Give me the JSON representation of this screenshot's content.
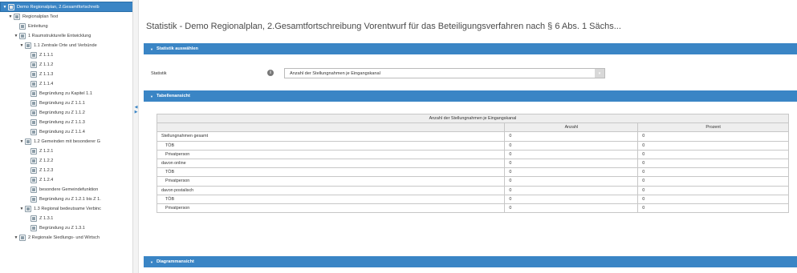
{
  "sidebar": {
    "items": [
      {
        "label": "Demo Regionalplan, 2.Gesamtfortschreib",
        "caret": "▼",
        "selected": true
      },
      {
        "label": "Regionalplan Text",
        "caret": "▼"
      },
      {
        "label": "Einleitung",
        "caret": ""
      },
      {
        "label": "1 Raumstrukturelle Entwicklung",
        "caret": "▼"
      },
      {
        "label": "1.1 Zentrale Orte und Verbünde",
        "caret": "▼"
      },
      {
        "label": "Z 1.1.1",
        "caret": ""
      },
      {
        "label": "Z 1.1.2",
        "caret": ""
      },
      {
        "label": "Z 1.1.3",
        "caret": ""
      },
      {
        "label": "Z 1.1.4",
        "caret": ""
      },
      {
        "label": "Begründung zu Kapitel 1.1",
        "caret": ""
      },
      {
        "label": "Begründung zu Z 1.1.1",
        "caret": ""
      },
      {
        "label": "Begründung zu Z 1.1.2",
        "caret": ""
      },
      {
        "label": "Begründung zu Z 1.1.3",
        "caret": ""
      },
      {
        "label": "Begründung zu Z 1.1.4",
        "caret": ""
      },
      {
        "label": "1.2 Gemeinden mit besonderer G",
        "caret": "▼"
      },
      {
        "label": "Z 1.2.1",
        "caret": ""
      },
      {
        "label": "Z 1.2.2",
        "caret": ""
      },
      {
        "label": "Z 1.2.3",
        "caret": ""
      },
      {
        "label": "Z 1.2.4",
        "caret": ""
      },
      {
        "label": "besondere Gemeindefunktion",
        "caret": ""
      },
      {
        "label": "Begründung zu Z 1.2.1 bis Z 1.",
        "caret": ""
      },
      {
        "label": "1.3 Regional bedeutsame Verbinc",
        "caret": "▼"
      },
      {
        "label": "Z 1.3.1",
        "caret": ""
      },
      {
        "label": "Begründung zu Z 1.3.1",
        "caret": ""
      },
      {
        "label": "2 Regionale Siedlungs- und Wirtsch",
        "caret": "▼"
      }
    ]
  },
  "main": {
    "title": "Statistik - Demo Regionalplan, 2.Gesamtfortschreibung Vorentwurf für das Beteiligungsverfahren nach § 6 Abs. 1 Sächs...",
    "panel_statistik": "Statistik auswählen",
    "statistik_label": "Statistik",
    "info_icon": "i",
    "statistik_value": "Anzahl der Stellungnahmen je Eingangskanal",
    "panel_tabelle": "Tabellenansicht",
    "panel_diagramm": "Diagrammansicht",
    "table": {
      "caption": "Anzahl der Stellungnahmen je Eingangskanal",
      "col_anzahl": "Anzahl",
      "col_prozent": "Prozent",
      "rows": [
        {
          "label": "Stellungnahmen gesamt",
          "anzahl": "0",
          "prozent": "0"
        },
        {
          "label": "TÖB",
          "anzahl": "0",
          "prozent": "0"
        },
        {
          "label": "Privatperson",
          "anzahl": "0",
          "prozent": "0"
        },
        {
          "label": "davon online",
          "anzahl": "0",
          "prozent": "0"
        },
        {
          "label": "TÖB",
          "anzahl": "0",
          "prozent": "0"
        },
        {
          "label": "Privatperson",
          "anzahl": "0",
          "prozent": "0"
        },
        {
          "label": "davon postalisch",
          "anzahl": "0",
          "prozent": "0"
        },
        {
          "label": "TÖB",
          "anzahl": "0",
          "prozent": "0"
        },
        {
          "label": "Privatperson",
          "anzahl": "0",
          "prozent": "0"
        }
      ]
    }
  },
  "icons": {
    "tree_node": "document-icon",
    "info": "info-icon",
    "collapse": "chevron-down-icon",
    "splitter": "splitter-arrows-icon"
  },
  "colors": {
    "accent": "#3a85c5",
    "node_icon": "#8c9da8"
  }
}
